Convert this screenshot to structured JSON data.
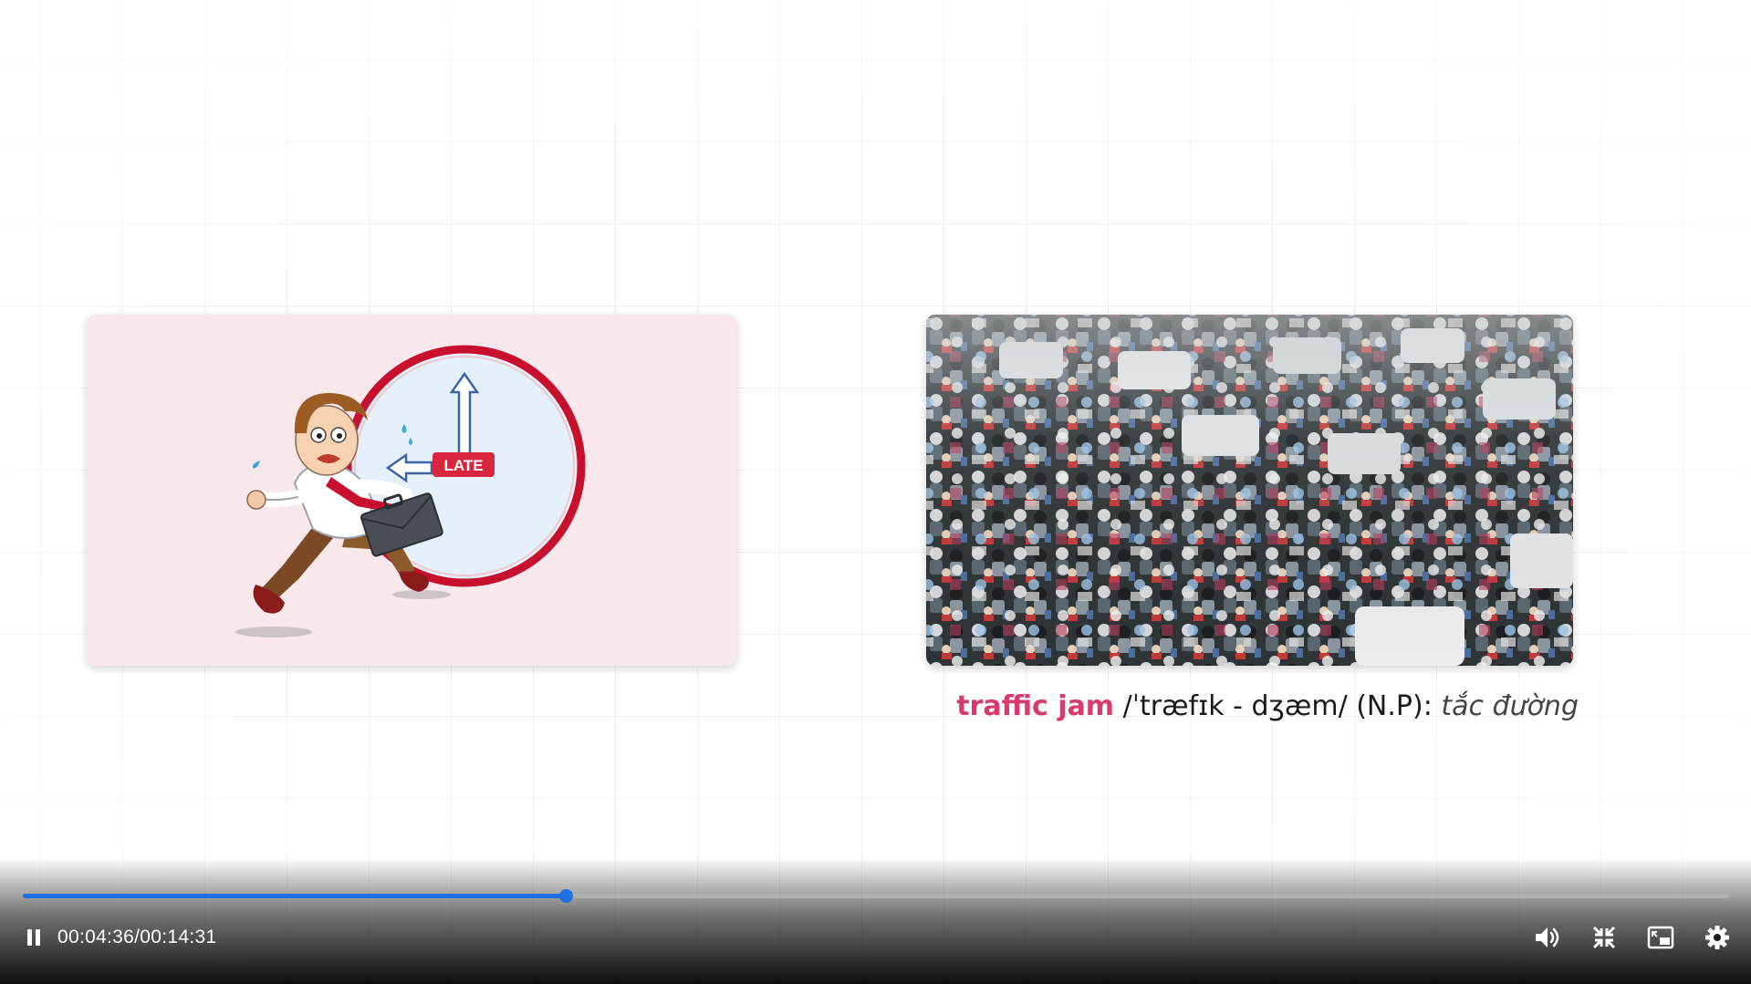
{
  "slide": {
    "illustration_badge": "LATE",
    "caption": {
      "term": "traffic jam",
      "ipa": "/ˈtræfɪk - dʒæm/ (N.P):",
      "meaning": "tắc đường"
    }
  },
  "player": {
    "current_time": "00:04:36",
    "duration": "00:14:31",
    "time_display": "00:04:36/00:14:31",
    "progress_fraction": 0.318,
    "accent_color": "#1f6fe5",
    "state": "playing",
    "icons": [
      "pause-icon",
      "volume-icon",
      "exit-fullscreen-icon",
      "picture-in-picture-icon",
      "settings-icon"
    ]
  }
}
